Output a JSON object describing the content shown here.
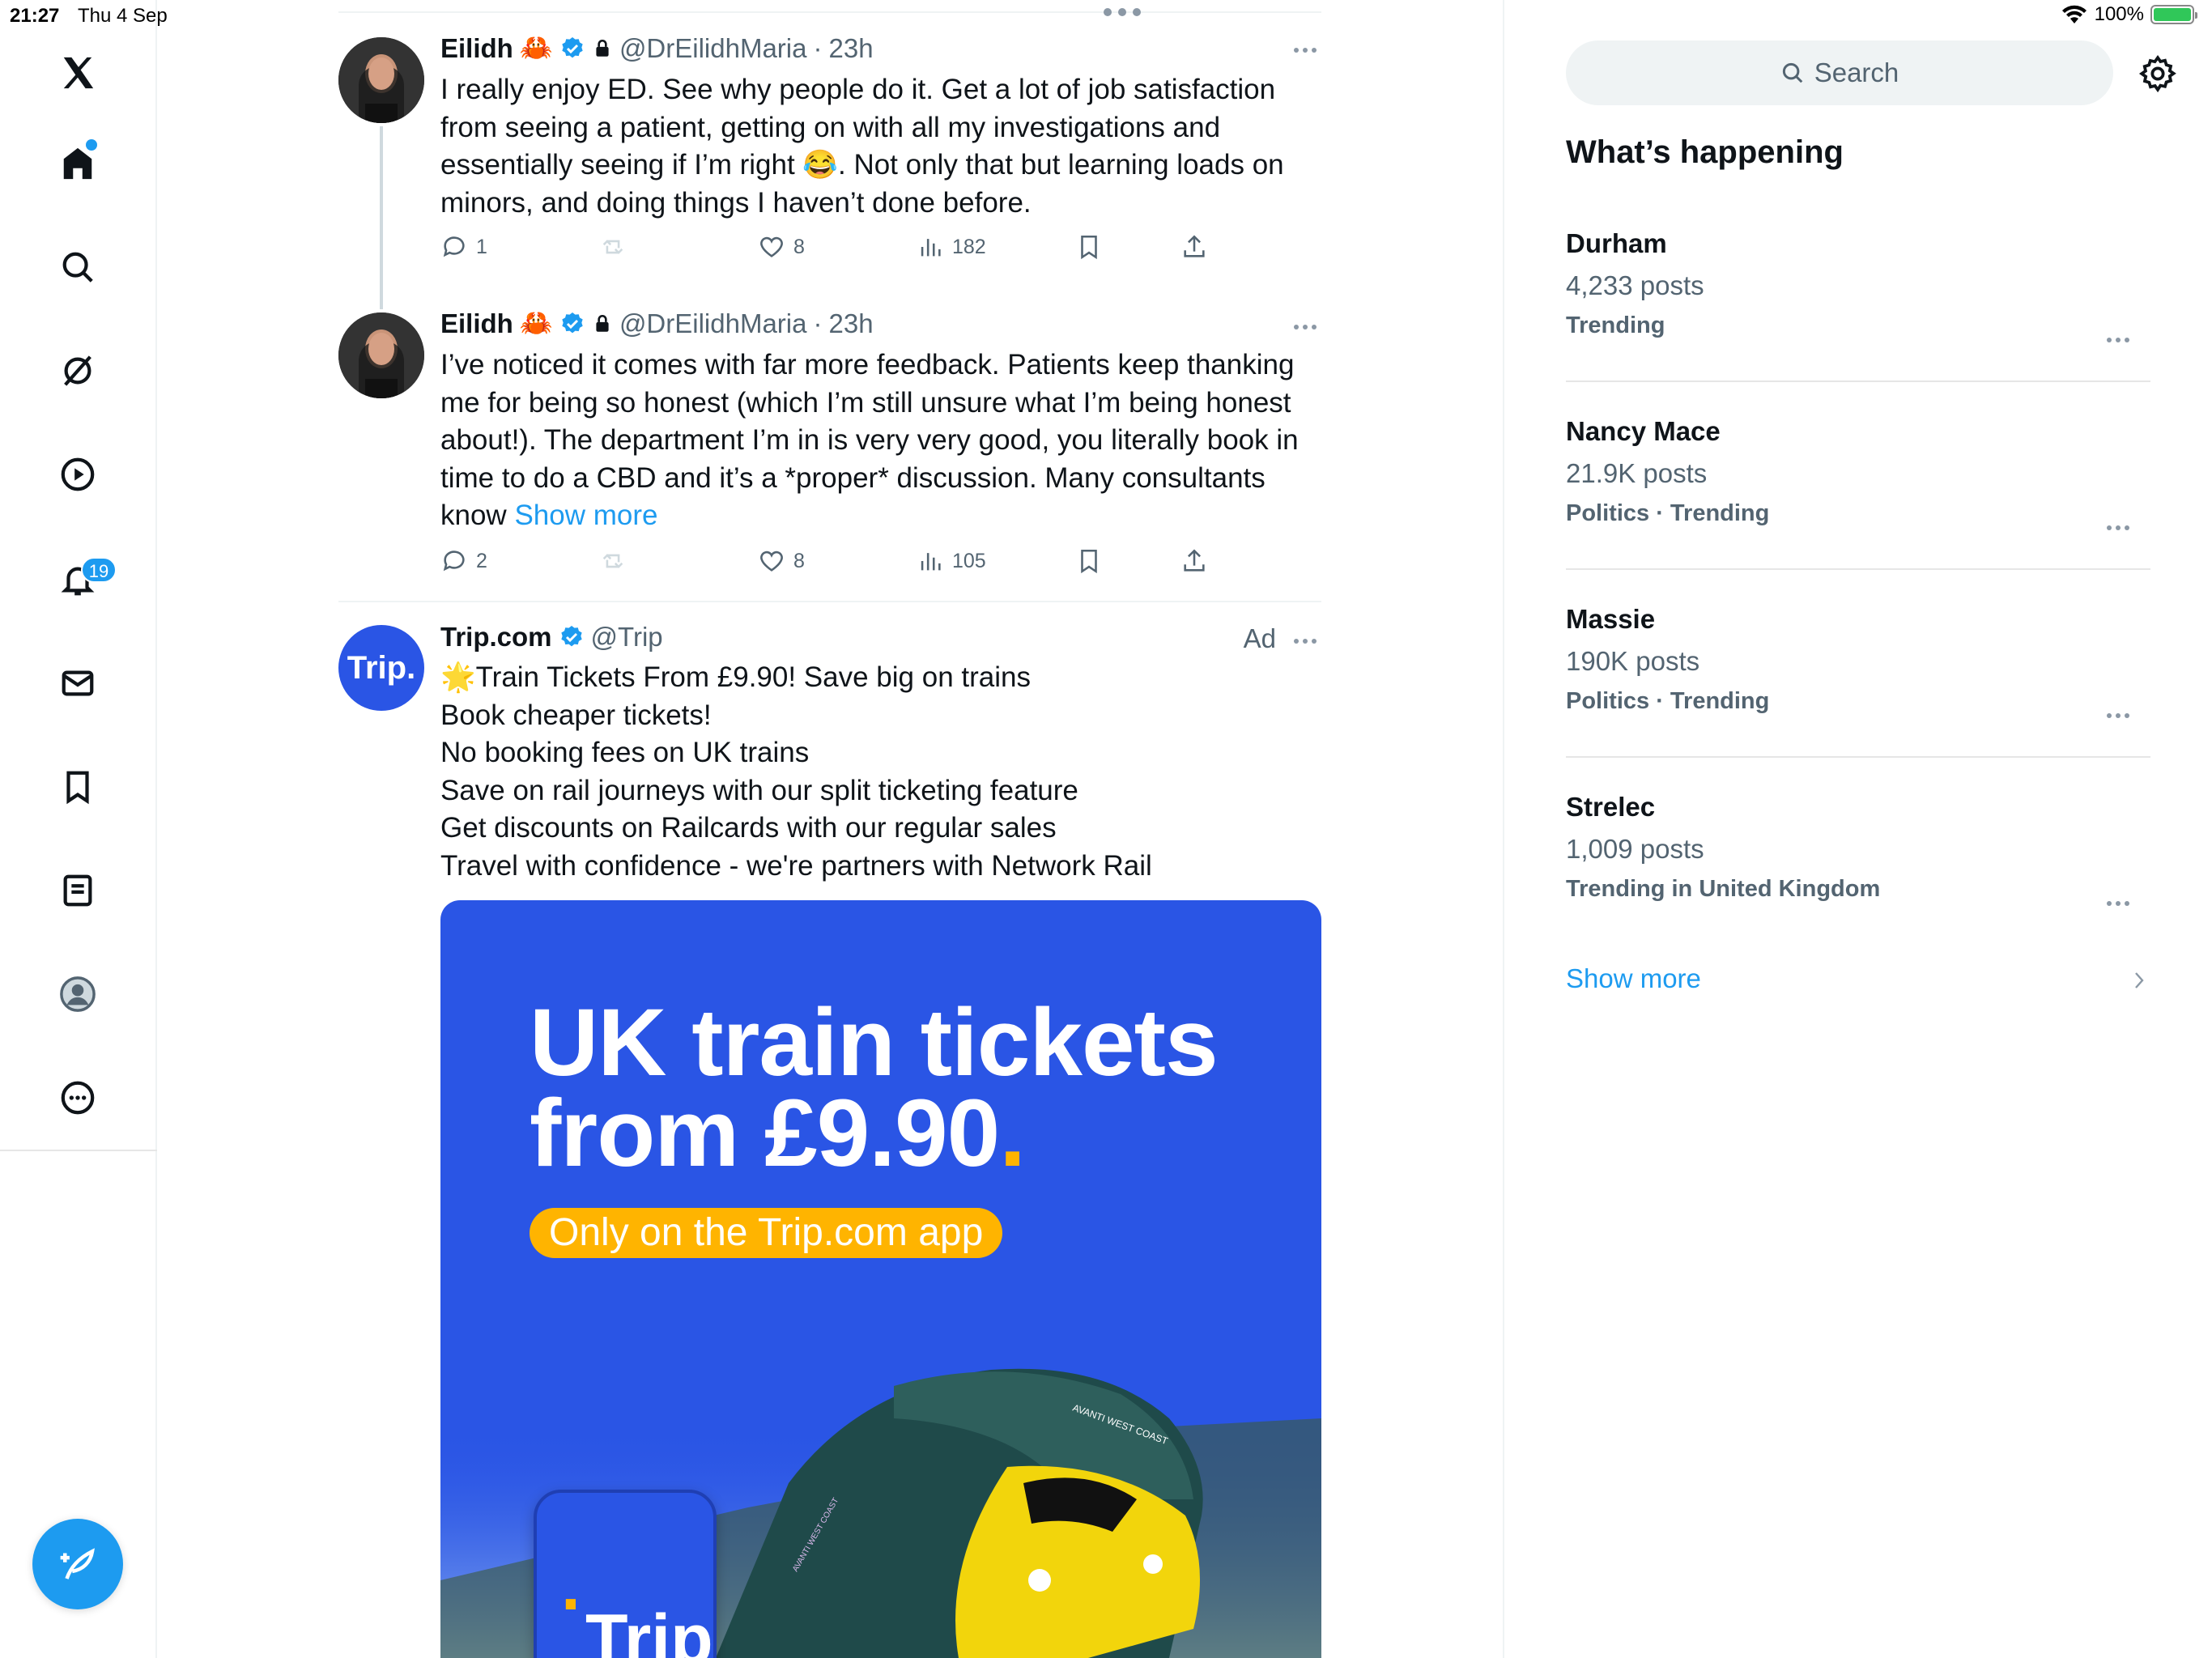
{
  "status_bar": {
    "time": "21:27",
    "date": "Thu 4 Sep",
    "battery": "100%"
  },
  "nav": {
    "items": [
      {
        "name": "x-logo",
        "icon": "x-logo-icon"
      },
      {
        "name": "home",
        "icon": "home-icon"
      },
      {
        "name": "explore",
        "icon": "search-icon"
      },
      {
        "name": "grok",
        "icon": "grok-icon"
      },
      {
        "name": "video",
        "icon": "play-icon"
      },
      {
        "name": "notifications",
        "icon": "bell-icon"
      },
      {
        "name": "messages",
        "icon": "envelope-icon"
      },
      {
        "name": "bookmarks",
        "icon": "bookmark-icon"
      },
      {
        "name": "lists",
        "icon": "list-icon"
      },
      {
        "name": "profile",
        "icon": "profile-icon"
      },
      {
        "name": "more",
        "icon": "more-circle-icon"
      }
    ],
    "notifications_badge": "19",
    "compose_icon": "compose-feather-icon"
  },
  "feed": {
    "tweets": [
      {
        "name": "Eilidh",
        "emoji": "🦀",
        "handle": "@DrEilidhMaria",
        "sep": "·",
        "ago": "23h",
        "text": "I really enjoy ED. See why people do it. Get a lot of job satisfaction from seeing a patient, getting on with all my investigations and essentially seeing if I’m right 😂. Not only that but learning loads on minors, and doing things I haven’t done before.",
        "replies": "1",
        "likes": "8",
        "views": "182"
      },
      {
        "name": "Eilidh",
        "emoji": "🦀",
        "handle": "@DrEilidhMaria",
        "sep": "·",
        "ago": "23h",
        "text": "I’ve noticed it comes with far more feedback. Patients keep thanking me for being so honest (which I’m still unsure what I’m being honest about!). The department I’m in is very very good, you literally book in time to do a CBD and it’s a *proper* discussion. Many consultants know",
        "show_more": "Show more",
        "replies": "2",
        "likes": "8",
        "views": "105"
      }
    ],
    "ad": {
      "name": "Trip.com",
      "handle": "@Trip",
      "label": "Ad",
      "avatar_text": "Trip.",
      "lines": [
        "🌟Train Tickets From £9.90! Save big on trains",
        "Book cheaper tickets!",
        "No booking fees on UK trains",
        "Save on rail journeys with our split ticketing feature",
        "Get discounts on Railcards with our regular sales",
        "Travel with confidence - we're partners with Network Rail"
      ],
      "image": {
        "headline_1": "UK train tickets",
        "headline_2": "from £9.90",
        "headline_dot": ".",
        "pill": "Only on the Trip.com app",
        "tile_text": "Trip",
        "tile_dot": ".",
        "train_text_1": "AVANTI WEST COAST",
        "train_text_2": "AVANTI WEST COAST"
      }
    }
  },
  "sidebar": {
    "search_placeholder": "Search",
    "title": "What’s happening",
    "trends": [
      {
        "name": "Durham",
        "count": "4,233 posts",
        "meta": "Trending"
      },
      {
        "name": "Nancy Mace",
        "count": "21.9K posts",
        "meta": "Politics · Trending"
      },
      {
        "name": "Massie",
        "count": "190K posts",
        "meta": "Politics · Trending"
      },
      {
        "name": "Strelec",
        "count": "1,009 posts",
        "meta": "Trending in United Kingdom"
      }
    ],
    "show_more": "Show more"
  },
  "colors": {
    "accent": "#1d9bf0",
    "trip_blue": "#2a55e5",
    "trip_yellow": "#ffb400"
  }
}
